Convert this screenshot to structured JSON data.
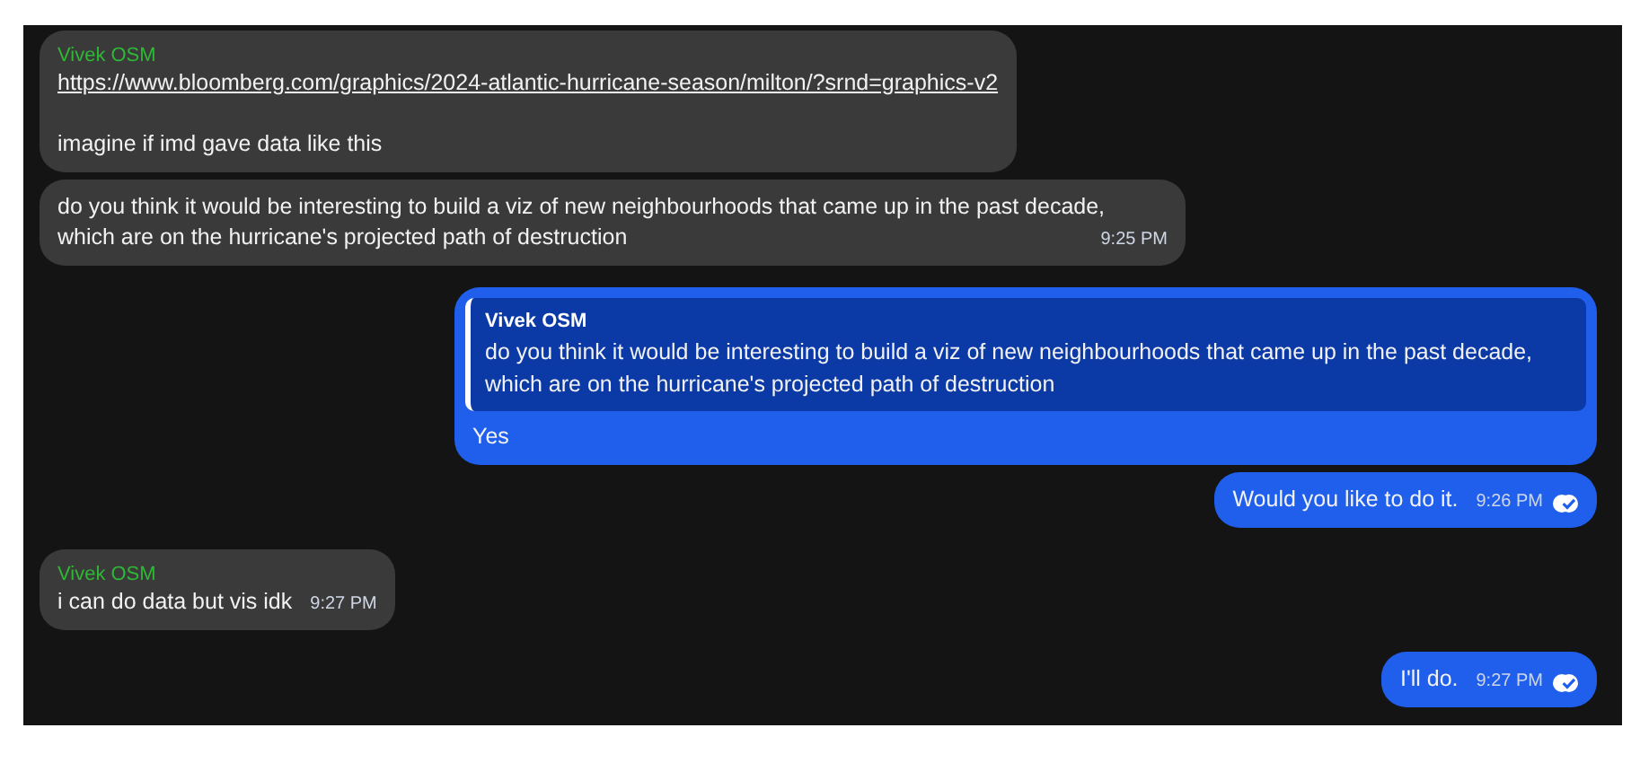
{
  "messages": [
    {
      "kind": "incoming",
      "sender": "Vivek OSM",
      "link": "https://www.bloomberg.com/graphics/2024-atlantic-hurricane-season/milton/?srnd=graphics-v2",
      "text": "imagine if imd gave data like this"
    },
    {
      "kind": "incoming",
      "text": "do you think it would be interesting to build a viz of new neighbourhoods that came up in the past decade, which are on the hurricane's projected path of destruction",
      "time": "9:25 PM"
    },
    {
      "kind": "outgoing",
      "quote": {
        "sender": "Vivek OSM",
        "text": "do you think it would be interesting to build a viz of new neighbourhoods that came up in the past decade, which are on the hurricane's projected path of destruction"
      },
      "text": "Yes"
    },
    {
      "kind": "outgoing",
      "text": "Would you like to do it.",
      "time": "9:26 PM",
      "read": true
    },
    {
      "kind": "incoming",
      "sender": "Vivek OSM",
      "text": "i can do data but vis idk",
      "time": "9:27 PM"
    },
    {
      "kind": "outgoing",
      "text": "I'll do.",
      "time": "9:27 PM",
      "read": true
    }
  ]
}
